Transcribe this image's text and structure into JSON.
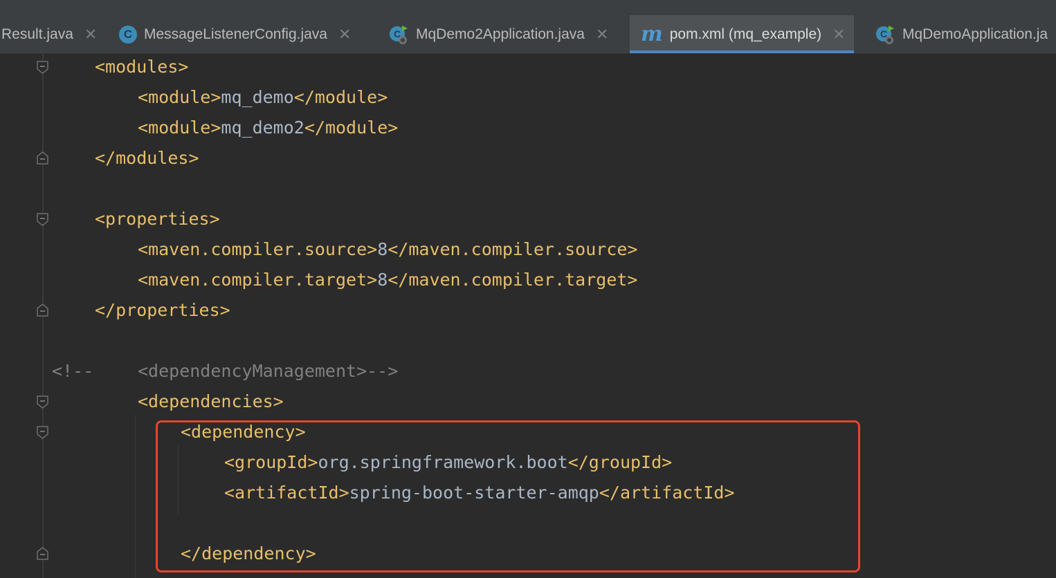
{
  "tabs": [
    {
      "label": "Result.java",
      "icon": "none"
    },
    {
      "label": "MessageListenerConfig.java",
      "icon": "class-icon"
    },
    {
      "label": "MqDemo2Application.java",
      "icon": "spring-boot-icon"
    },
    {
      "label": "pom.xml (mq_example)",
      "icon": "maven-icon",
      "active": true
    },
    {
      "label": "MqDemoApplication.ja",
      "icon": "spring-boot-icon"
    }
  ],
  "colors": {
    "tag": "#e8bf6a",
    "text": "#a9b7c6",
    "comment": "#808080",
    "highlight": "#e8432f",
    "accent": "#4a88c7"
  },
  "code": {
    "l1": "<modules>",
    "l2_open": "<module>",
    "l2_text": "mq_demo",
    "l2_close": "</module>",
    "l3_open": "<module>",
    "l3_text": "mq_demo2",
    "l3_close": "</module>",
    "l4": "</modules>",
    "l6": "<properties>",
    "l7_open": "<maven.compiler.source>",
    "l7_text": "8",
    "l7_close": "</maven.compiler.source>",
    "l8_open": "<maven.compiler.target>",
    "l8_text": "8",
    "l8_close": "</maven.compiler.target>",
    "l9": "</properties>",
    "l11_comment_a": "<!--",
    "l11_comment_b": "<dependencyManagement>-->",
    "l12": "<dependencies>",
    "l13": "<dependency>",
    "l14_open": "<groupId>",
    "l14_text": "org.springframework.boot",
    "l14_close": "</groupId>",
    "l15_open": "<artifactId>",
    "l15_text": "spring-boot-starter-amqp",
    "l15_close": "</artifactId>",
    "l17": "</dependency>"
  }
}
